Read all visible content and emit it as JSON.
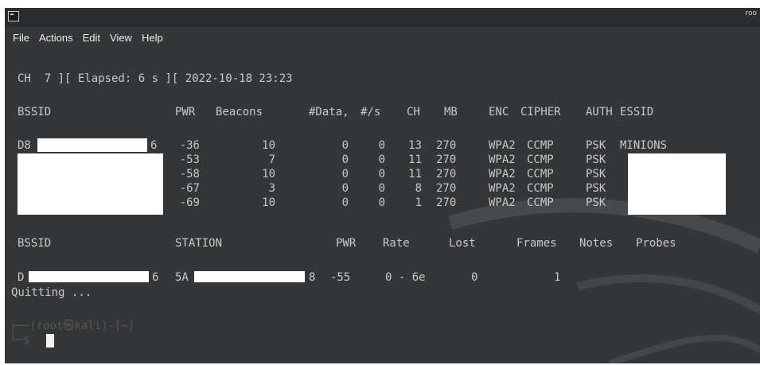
{
  "window": {
    "title": "roo"
  },
  "menu": [
    "File",
    "Actions",
    "Edit",
    "View",
    "Help"
  ],
  "status_line": "CH  7 ][ Elapsed: 6 s ][ 2022-10-18 23:23",
  "ap_headers": [
    "BSSID",
    "PWR",
    "Beacons",
    "#Data,",
    "#/s",
    "CH",
    "MB",
    "ENC",
    "CIPHER",
    "AUTH",
    "ESSID"
  ],
  "ap_rows": [
    {
      "bssid_start": "D8",
      "bssid_end": "6",
      "pwr": "-36",
      "beacons": "10",
      "data": "0",
      "per_s": "0",
      "ch": "13",
      "mb": "270",
      "enc": "WPA2",
      "cipher": "CCMP",
      "auth": "PSK",
      "essid": "MINIONS"
    },
    {
      "bssid_start": "",
      "bssid_end": "",
      "pwr": "-53",
      "beacons": "7",
      "data": "0",
      "per_s": "0",
      "ch": "11",
      "mb": "270",
      "enc": "WPA2",
      "cipher": "CCMP",
      "auth": "PSK",
      "essid": ""
    },
    {
      "bssid_start": "",
      "bssid_end": "",
      "pwr": "-58",
      "beacons": "10",
      "data": "0",
      "per_s": "0",
      "ch": "11",
      "mb": "270",
      "enc": "WPA2",
      "cipher": "CCMP",
      "auth": "PSK",
      "essid": ""
    },
    {
      "bssid_start": "",
      "bssid_end": "",
      "pwr": "-67",
      "beacons": "3",
      "data": "0",
      "per_s": "0",
      "ch": "8",
      "mb": "270",
      "enc": "WPA2",
      "cipher": "CCMP",
      "auth": "PSK",
      "essid": ""
    },
    {
      "bssid_start": "",
      "bssid_end": "",
      "pwr": "-69",
      "beacons": "10",
      "data": "0",
      "per_s": "0",
      "ch": "1",
      "mb": "270",
      "enc": "WPA2",
      "cipher": "CCMP",
      "auth": "PSK",
      "essid": ""
    }
  ],
  "station_headers": [
    "BSSID",
    "STATION",
    "PWR",
    "Rate",
    "Lost",
    "Frames",
    "Notes",
    "Probes"
  ],
  "station_rows": [
    {
      "bssid_start": "D",
      "bssid_end": "6",
      "station_start": "5A",
      "station_end": "8",
      "pwr": "-55",
      "rate": "0 - 6e",
      "lost": "0",
      "frames": "1"
    }
  ],
  "quitting": "Quitting ...",
  "prompt": {
    "line1": "┌──(root㉿kali)-[~]",
    "line2": "└─$"
  },
  "colors": {
    "terminal_bg": "#343638",
    "text": "#c8c8c8",
    "redaction": "#ffffff"
  }
}
